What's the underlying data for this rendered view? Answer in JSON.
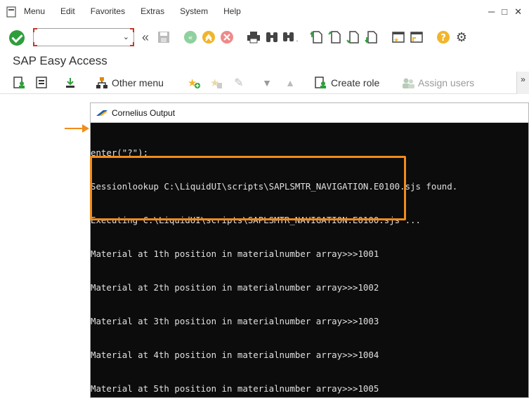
{
  "menubar": {
    "items": [
      "Menu",
      "Edit",
      "Favorites",
      "Extras",
      "System",
      "Help"
    ],
    "window_controls": [
      "─",
      "□",
      "✕"
    ]
  },
  "toolbar": {
    "command_field": {
      "value": "",
      "placeholder": ""
    }
  },
  "title": "SAP Easy Access",
  "appbar": {
    "other_menu": "Other menu",
    "create_role": "Create role",
    "assign_users": "Assign users",
    "more": "»"
  },
  "output_window": {
    "title": "Cornelius Output",
    "lines": [
      "enter(\"?\");",
      "Sessionlookup C:\\LiquidUI\\scripts\\SAPLSMTR_NAVIGATION.E0100.sjs found.",
      "Executing C:\\LiquidUI\\scripts\\SAPLSMTR_NAVIGATION.E0100.sjs ...",
      "Material at 1th position in materialnumber array>>>1001",
      "Material at 2th position in materialnumber array>>>1002",
      "Material at 3th position in materialnumber array>>>1003",
      "Material at 4th position in materialnumber array>>>1004",
      "Material at 5th position in materialnumber array>>>1005"
    ]
  },
  "colors": {
    "accent_orange": "#f28c1a",
    "console_bg": "#0c0c0c",
    "ok_green": "#2e9e3b"
  }
}
